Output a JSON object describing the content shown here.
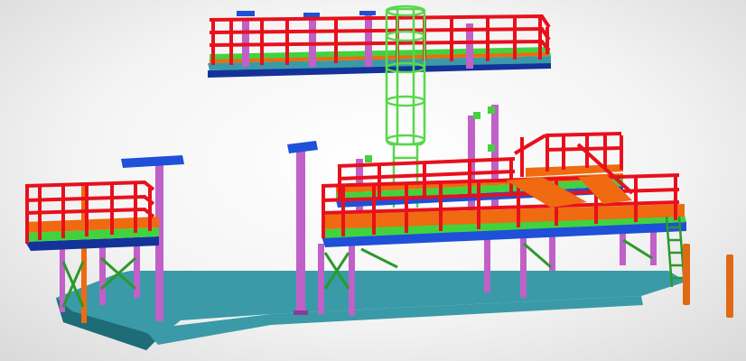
{
  "scene": {
    "kind": "3d-structural-steel-model",
    "colors": {
      "railing": "#e8101c",
      "railing_dark": "#b40812",
      "column_purple": "#c060c8",
      "column_purple_dark": "#8e3a98",
      "beam_blue": "#1e50d8",
      "beam_blue_dark": "#13339a",
      "deck_orange": "#ef6a10",
      "grating_green": "#42d23e",
      "grating_green_dark": "#2a9a2a",
      "base_slab": "#3a9aa8",
      "base_slab_dark": "#1e6c78",
      "ladder_green": "#58d84a",
      "pipe_orange": "#e06a14"
    },
    "components": [
      "upper-platform",
      "cage-ladder",
      "left-platform",
      "main-platform",
      "stair-platform",
      "base-slab",
      "standalone-column",
      "side-ladder",
      "orange-pipes"
    ]
  }
}
